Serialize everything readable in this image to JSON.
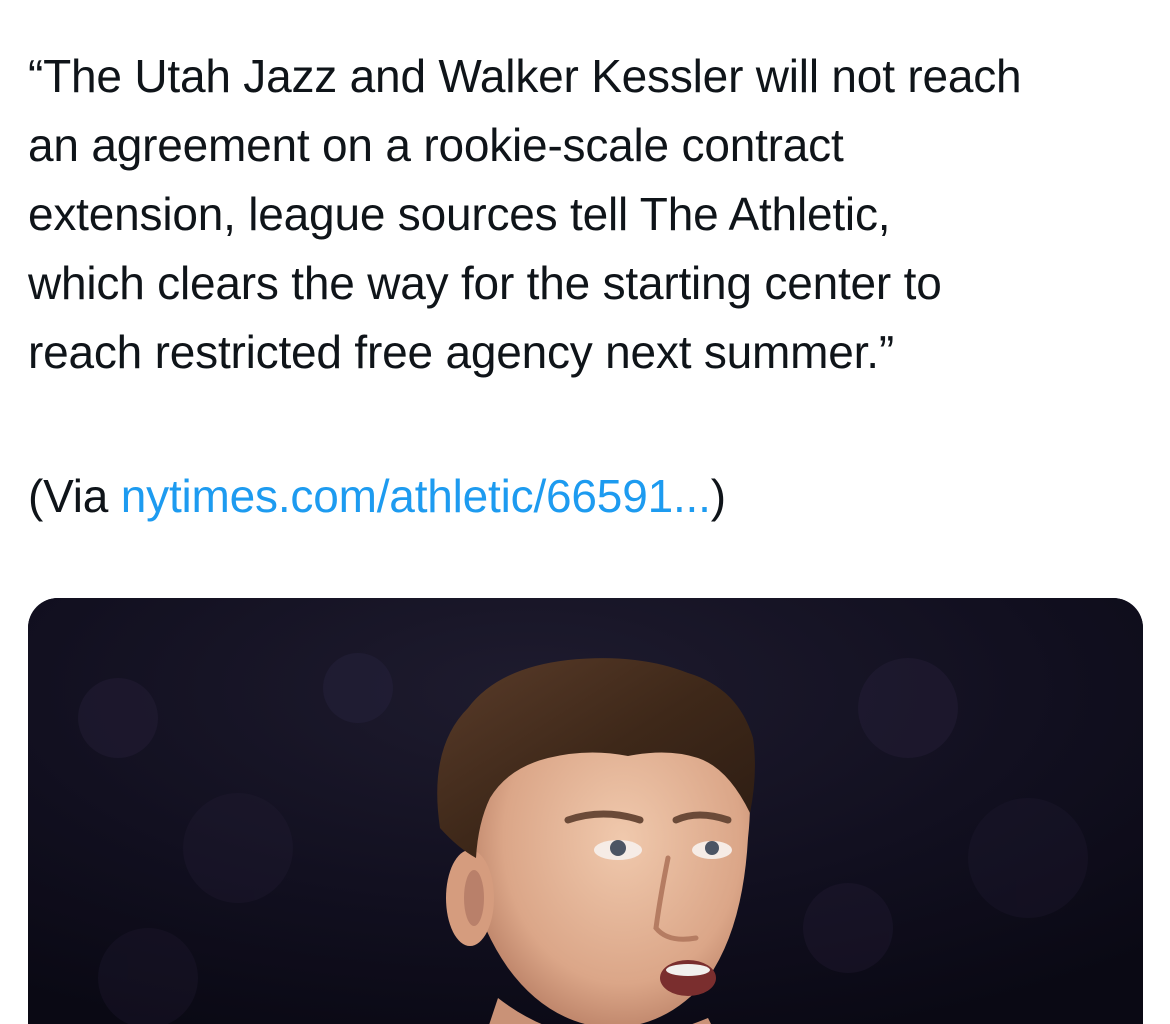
{
  "tweet": {
    "text_lines": [
      "“The Utah Jazz and Walker Kessler will not reach",
      "an agreement on a rookie-scale contract",
      "extension, league sources tell The Athletic,",
      "which clears the way for the starting center to",
      "reach restricted free agency next summer.”"
    ],
    "via": {
      "prefix": "(Via ",
      "link_text": "nytimes.com/athletic/66591...",
      "suffix": ")"
    }
  },
  "media": {
    "alt_subject": "photo"
  },
  "colors": {
    "text": "#0f1419",
    "link": "#1d9bf0",
    "photo_background": "#0e0d1c"
  }
}
